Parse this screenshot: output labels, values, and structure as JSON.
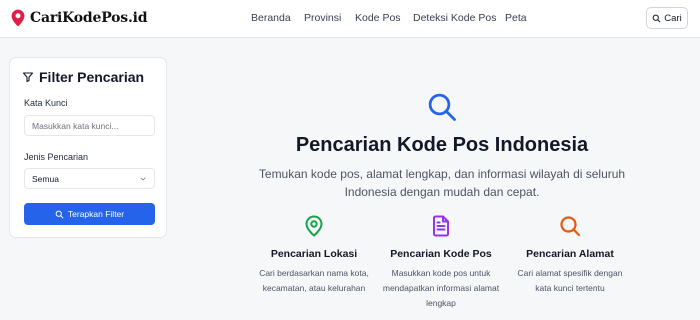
{
  "header": {
    "logo_text": "CariKodePos.id",
    "nav": [
      "Beranda",
      "Provinsi",
      "Kode Pos",
      "Deteksi Kode Pos",
      "Peta"
    ],
    "search_button": "Cari"
  },
  "filter": {
    "title": "Filter Pencarian",
    "keyword_label": "Kata Kunci",
    "keyword_placeholder": "Masukkan kata kunci...",
    "type_label": "Jenis Pencarian",
    "type_selected": "Semua",
    "apply_button": "Terapkan Filter"
  },
  "hero": {
    "title": "Pencarian Kode Pos Indonesia",
    "subtitle": "Temukan kode pos, alamat lengkap, dan informasi wilayah di seluruh Indonesia dengan mudah dan cepat."
  },
  "features": [
    {
      "icon": "map-pin-icon",
      "title": "Pencarian Lokasi",
      "desc": "Cari berdasarkan nama kota, kecamatan, atau kelurahan",
      "color": "#16a34a"
    },
    {
      "icon": "document-icon",
      "title": "Pencarian Kode Pos",
      "desc": "Masukkan kode pos untuk mendapatkan informasi alamat lengkap",
      "color": "#9333ea"
    },
    {
      "icon": "search-icon",
      "title": "Pencarian Alamat",
      "desc": "Cari alamat spesifik dengan kata kunci tertentu",
      "color": "#ea580c"
    }
  ],
  "colors": {
    "primary": "#2563eb",
    "logo_pin": "#e11d48"
  }
}
